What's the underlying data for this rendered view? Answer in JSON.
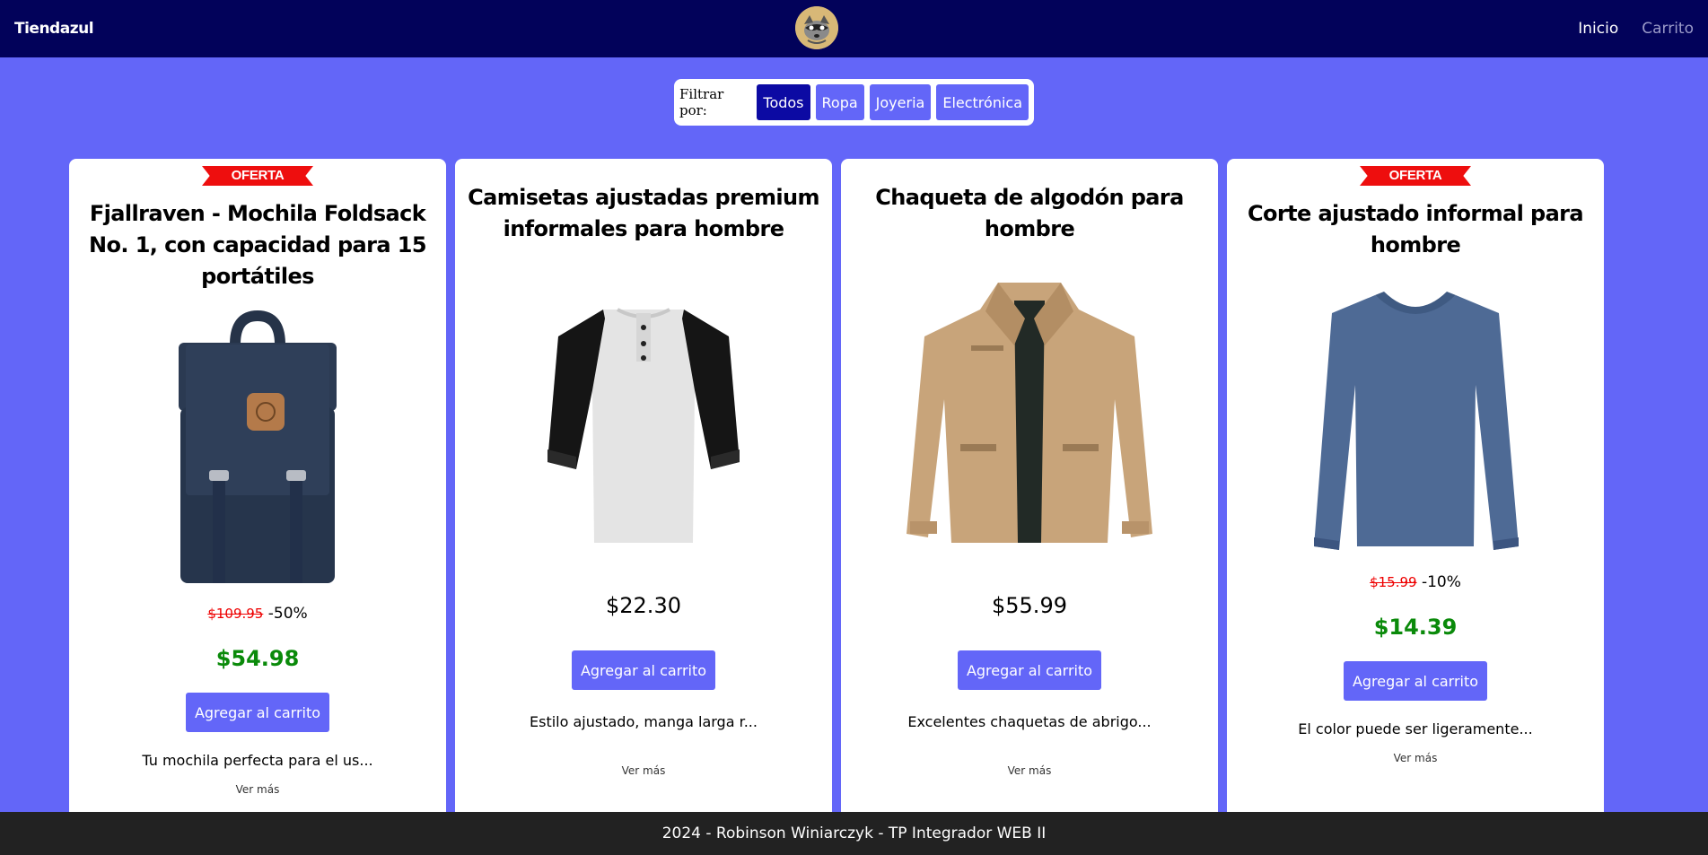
{
  "header": {
    "brand": "Tiendazul",
    "logo_icon": "raccoon-logo-icon",
    "nav": [
      {
        "label": "Inicio",
        "active": true
      },
      {
        "label": "Carrito",
        "active": false
      }
    ]
  },
  "filter": {
    "label": "Filtrar por:",
    "options": [
      {
        "label": "Todos",
        "active": true
      },
      {
        "label": "Ropa",
        "active": false
      },
      {
        "label": "Joyeria",
        "active": false
      },
      {
        "label": "Electrónica",
        "active": false
      }
    ]
  },
  "products": [
    {
      "badge": "OFERTA",
      "title": "Fjallraven - Mochila Foldsack No. 1, con capacidad para 15 portátiles",
      "image_icon": "backpack-image",
      "old_price": "$109.95",
      "discount": "-50%",
      "price": "$54.98",
      "button": "Agregar al carrito",
      "description": "Tu mochila perfecta para el us...",
      "more": "Ver más"
    },
    {
      "badge": "",
      "title": "Camisetas ajustadas premium informales para hombre",
      "image_icon": "raglan-shirt-image",
      "old_price": "",
      "discount": "",
      "price": "$22.30",
      "button": "Agregar al carrito",
      "description": "Estilo ajustado, manga larga r...",
      "more": "Ver más"
    },
    {
      "badge": "",
      "title": "Chaqueta de algodón para hombre",
      "image_icon": "jacket-image",
      "old_price": "",
      "discount": "",
      "price": "$55.99",
      "button": "Agregar al carrito",
      "description": "Excelentes chaquetas de abrigo...",
      "more": "Ver más"
    },
    {
      "badge": "OFERTA",
      "title": "Corte ajustado informal para hombre",
      "image_icon": "long-sleeve-tee-image",
      "old_price": "$15.99",
      "discount": "-10%",
      "price": "$14.39",
      "button": "Agregar al carrito",
      "description": "El color puede ser ligeramente...",
      "more": "Ver más"
    }
  ],
  "footer": {
    "text": "2024 - Robinson Winiarczyk - TP Integrador WEB II"
  },
  "colors": {
    "header_bg": "#02025a",
    "page_bg": "#6366f8",
    "accent": "#6366f8",
    "active_filter": "#0c0aa3",
    "sale_green": "#0a8a0a",
    "old_price_red": "#ee0000",
    "ribbon_red": "#ee0e0e",
    "footer_bg": "#222222"
  }
}
